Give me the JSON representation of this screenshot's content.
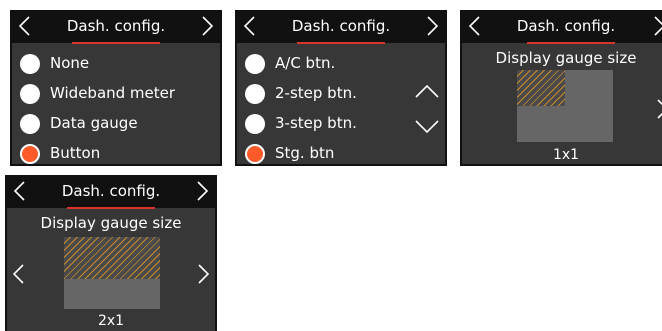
{
  "screens": [
    {
      "title": "Dash. config.",
      "items": [
        {
          "label": "None",
          "selected": false
        },
        {
          "label": "Wideband meter",
          "selected": false
        },
        {
          "label": "Data gauge",
          "selected": false
        },
        {
          "label": "Button",
          "selected": true
        }
      ]
    },
    {
      "title": "Dash. config.",
      "items": [
        {
          "label": "A/C btn.",
          "selected": false
        },
        {
          "label": "2-step btn.",
          "selected": false
        },
        {
          "label": "3-step btn.",
          "selected": false
        },
        {
          "label": "Stg. btn",
          "selected": true
        }
      ],
      "scroll_up_icon": "chevron-up-icon",
      "scroll_down_icon": "chevron-down-icon"
    },
    {
      "title": "Dash. config.",
      "gauge_title": "Display gauge size",
      "size": "1x1"
    },
    {
      "title": "Dash. config.",
      "gauge_title": "Display gauge size",
      "size": "2x1"
    }
  ],
  "colors": {
    "background": "#373737",
    "header": "#111111",
    "accent": "#d8342a",
    "selected_radio": "#ff5a2a",
    "hatch": "#c98a2d",
    "gauge_cell": "#666666"
  }
}
